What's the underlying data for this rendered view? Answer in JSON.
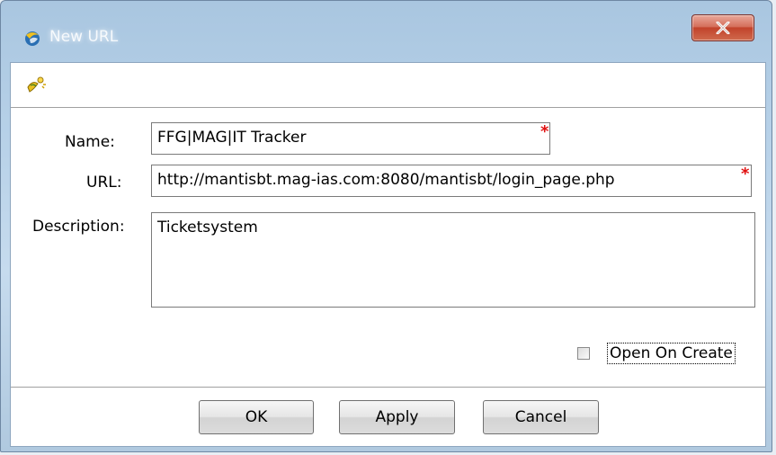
{
  "window": {
    "title": "New URL",
    "app_icon": "app-logo-icon",
    "close_icon": "close-x-icon"
  },
  "toolbar": {
    "wizard_icon": "wizard-icon"
  },
  "form": {
    "name_label": "Name:",
    "name_value": "FFG|MAG|IT Tracker",
    "url_label": "URL:",
    "url_value": "http://mantisbt.mag-ias.com:8080/mantisbt/login_page.php",
    "description_label": "Description:",
    "description_value": "Ticketsystem",
    "required_marker": "*",
    "open_on_create_label": "Open On Create",
    "open_on_create_checked": false
  },
  "buttons": {
    "ok_label": "OK",
    "apply_label": "Apply",
    "cancel_label": "Cancel"
  },
  "colors": {
    "required": "#e01010",
    "close_button": "#c2432b",
    "title_bar": "#b7d1e8"
  }
}
